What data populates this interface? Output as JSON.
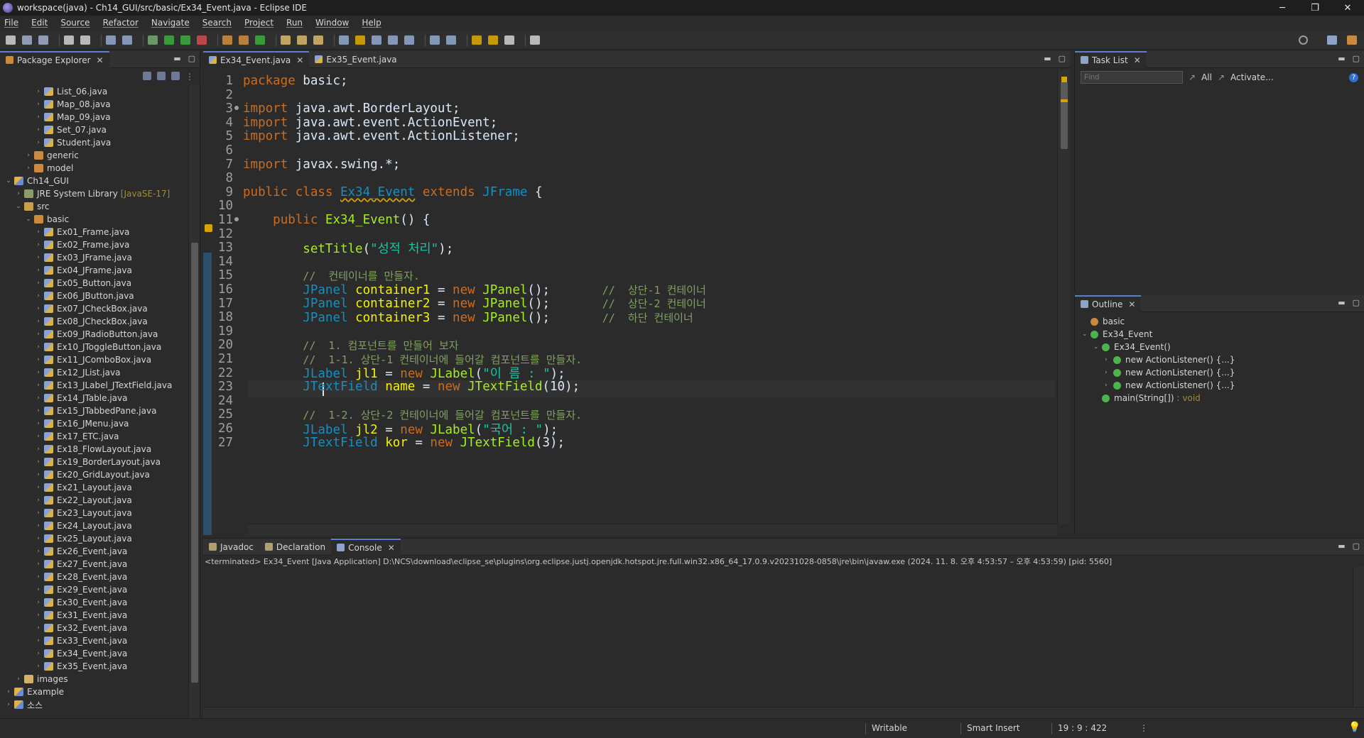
{
  "window": {
    "title": "workspace(java) - Ch14_GUI/src/basic/Ex34_Event.java - Eclipse IDE",
    "minimize": "─",
    "maximize": "❐",
    "close": "✕"
  },
  "menu": [
    "File",
    "Edit",
    "Source",
    "Refactor",
    "Navigate",
    "Search",
    "Project",
    "Run",
    "Window",
    "Help"
  ],
  "package_explorer": {
    "tab": "Package Explorer",
    "rows": [
      {
        "label": "List_06.java",
        "level": 3,
        "icon": "java"
      },
      {
        "label": "Map_08.java",
        "level": 3,
        "icon": "java"
      },
      {
        "label": "Map_09.java",
        "level": 3,
        "icon": "java"
      },
      {
        "label": "Set_07.java",
        "level": 3,
        "icon": "java"
      },
      {
        "label": "Student.java",
        "level": 3,
        "icon": "java"
      },
      {
        "label": "generic",
        "level": 2,
        "icon": "pkg"
      },
      {
        "label": "model",
        "level": 2,
        "icon": "pkg"
      },
      {
        "label": "Ch14_GUI",
        "level": 0,
        "icon": "proj",
        "expanded": true
      },
      {
        "label": "JRE System Library",
        "decor": "[JavaSE-17]",
        "level": 1,
        "icon": "lib"
      },
      {
        "label": "src",
        "level": 1,
        "icon": "src",
        "expanded": true
      },
      {
        "label": "basic",
        "level": 2,
        "icon": "pkg",
        "expanded": true
      },
      {
        "label": "Ex01_Frame.java",
        "level": 3,
        "icon": "java"
      },
      {
        "label": "Ex02_Frame.java",
        "level": 3,
        "icon": "java"
      },
      {
        "label": "Ex03_JFrame.java",
        "level": 3,
        "icon": "java"
      },
      {
        "label": "Ex04_JFrame.java",
        "level": 3,
        "icon": "java"
      },
      {
        "label": "Ex05_Button.java",
        "level": 3,
        "icon": "java"
      },
      {
        "label": "Ex06_JButton.java",
        "level": 3,
        "icon": "java"
      },
      {
        "label": "Ex07_JCheckBox.java",
        "level": 3,
        "icon": "java"
      },
      {
        "label": "Ex08_JCheckBox.java",
        "level": 3,
        "icon": "java"
      },
      {
        "label": "Ex09_JRadioButton.java",
        "level": 3,
        "icon": "java"
      },
      {
        "label": "Ex10_JToggleButton.java",
        "level": 3,
        "icon": "java"
      },
      {
        "label": "Ex11_JComboBox.java",
        "level": 3,
        "icon": "java"
      },
      {
        "label": "Ex12_JList.java",
        "level": 3,
        "icon": "java"
      },
      {
        "label": "Ex13_JLabel_JTextField.java",
        "level": 3,
        "icon": "java"
      },
      {
        "label": "Ex14_JTable.java",
        "level": 3,
        "icon": "java"
      },
      {
        "label": "Ex15_JTabbedPane.java",
        "level": 3,
        "icon": "java"
      },
      {
        "label": "Ex16_JMenu.java",
        "level": 3,
        "icon": "java"
      },
      {
        "label": "Ex17_ETC.java",
        "level": 3,
        "icon": "java"
      },
      {
        "label": "Ex18_FlowLayout.java",
        "level": 3,
        "icon": "java"
      },
      {
        "label": "Ex19_BorderLayout.java",
        "level": 3,
        "icon": "java"
      },
      {
        "label": "Ex20_GridLayout.java",
        "level": 3,
        "icon": "java"
      },
      {
        "label": "Ex21_Layout.java",
        "level": 3,
        "icon": "java"
      },
      {
        "label": "Ex22_Layout.java",
        "level": 3,
        "icon": "java"
      },
      {
        "label": "Ex23_Layout.java",
        "level": 3,
        "icon": "java"
      },
      {
        "label": "Ex24_Layout.java",
        "level": 3,
        "icon": "java"
      },
      {
        "label": "Ex25_Layout.java",
        "level": 3,
        "icon": "java"
      },
      {
        "label": "Ex26_Event.java",
        "level": 3,
        "icon": "java"
      },
      {
        "label": "Ex27_Event.java",
        "level": 3,
        "icon": "java"
      },
      {
        "label": "Ex28_Event.java",
        "level": 3,
        "icon": "java"
      },
      {
        "label": "Ex29_Event.java",
        "level": 3,
        "icon": "java"
      },
      {
        "label": "Ex30_Event.java",
        "level": 3,
        "icon": "java"
      },
      {
        "label": "Ex31_Event.java",
        "level": 3,
        "icon": "java"
      },
      {
        "label": "Ex32_Event.java",
        "level": 3,
        "icon": "java"
      },
      {
        "label": "Ex33_Event.java",
        "level": 3,
        "icon": "java"
      },
      {
        "label": "Ex34_Event.java",
        "level": 3,
        "icon": "java"
      },
      {
        "label": "Ex35_Event.java",
        "level": 3,
        "icon": "java"
      },
      {
        "label": "images",
        "level": 1,
        "icon": "folder"
      },
      {
        "label": "Example",
        "level": 0,
        "icon": "proj"
      },
      {
        "label": "소스",
        "level": 0,
        "icon": "proj"
      }
    ]
  },
  "editor": {
    "tabs": [
      {
        "label": "Ex34_Event.java",
        "active": true
      },
      {
        "label": "Ex35_Event.java",
        "active": false
      }
    ],
    "lines": [
      {
        "n": "1",
        "html": "<span class='kw'>package</span> basic;"
      },
      {
        "n": "2",
        "html": ""
      },
      {
        "n": "3",
        "html": "<span class='kw'>import</span> java.awt.BorderLayout;"
      },
      {
        "n": "4",
        "html": "<span class='kw'>import</span> java.awt.event.ActionEvent;"
      },
      {
        "n": "5",
        "html": "<span class='kw'>import</span> java.awt.event.ActionListener;"
      },
      {
        "n": "6",
        "html": ""
      },
      {
        "n": "7",
        "html": "<span class='kw'>import</span> javax.swing.*;"
      },
      {
        "n": "8",
        "html": ""
      },
      {
        "n": "9",
        "html": "<span class='kw'>public class</span> <span class='cl'>Ex34_Event</span> <span class='kw'>extends</span> <span class='ty'>JFrame</span> {"
      },
      {
        "n": "10",
        "html": ""
      },
      {
        "n": "11",
        "html": "    <span class='kw'>public</span> <span class='fn'>Ex34_Event</span>() {"
      },
      {
        "n": "12",
        "html": ""
      },
      {
        "n": "13",
        "html": "        <span class='fn'>setTitle</span>(<span class='st'>\"성적 처리\"</span>);"
      },
      {
        "n": "14",
        "html": ""
      },
      {
        "n": "15",
        "html": "        <span class='cm'>//  컨테이너를 만들자.</span>"
      },
      {
        "n": "16",
        "html": "        <span class='ty'>JPanel</span> <span class='ident'>container1</span> = <span class='kw'>new</span> <span class='fn'>JPanel</span>();       <span class='cm'>//  상단-1 컨테이너</span>"
      },
      {
        "n": "17",
        "html": "        <span class='ty'>JPanel</span> <span class='ident'>container2</span> = <span class='kw'>new</span> <span class='fn'>JPanel</span>();       <span class='cm'>//  상단-2 컨테이너</span>"
      },
      {
        "n": "18",
        "html": "        <span class='ty'>JPanel</span> <span class='ident'>container3</span> = <span class='kw'>new</span> <span class='fn'>JPanel</span>();       <span class='cm'>//  하단 컨테이너</span>"
      },
      {
        "n": "19",
        "html": "        "
      },
      {
        "n": "20",
        "html": "        <span class='cm'>//  1. 컴포넌트를 만들어 보자</span>"
      },
      {
        "n": "21",
        "html": "        <span class='cm'>//  1-1. 상단-1 컨테이너에 들어갈 컴포넌트를 만들자.</span>"
      },
      {
        "n": "22",
        "html": "        <span class='ty'>JLabel</span> <span class='ident'>jl1</span> = <span class='kw'>new</span> <span class='fn'>JLabel</span>(<span class='st'>\"이 름 : \"</span>);"
      },
      {
        "n": "23",
        "html": "        <span class='ty'>JTextField</span> <span class='ident'>name</span> = <span class='kw'>new</span> <span class='fn'>JTextField</span>(10);"
      },
      {
        "n": "24",
        "html": ""
      },
      {
        "n": "25",
        "html": "        <span class='cm'>//  1-2. 상단-2 컨테이너에 들어갈 컴포넌트를 만들자.</span>"
      },
      {
        "n": "26",
        "html": "        <span class='ty'>JLabel</span> <span class='ident'>jl2</span> = <span class='kw'>new</span> <span class='fn'>JLabel</span>(<span class='st'>\"국어 : \"</span>);"
      },
      {
        "n": "27",
        "html": "        <span class='ty'>JTextField</span> <span class='ident'>kor</span> = <span class='kw'>new</span> <span class='fn'>JTextField</span>(3);"
      }
    ]
  },
  "task_list": {
    "tab": "Task List",
    "find_placeholder": "Find",
    "all": "All",
    "activate": "Activate..."
  },
  "outline": {
    "tab": "Outline",
    "rows": [
      {
        "label": "basic",
        "level": 0,
        "color": "#c98a3e"
      },
      {
        "label": "Ex34_Event",
        "level": 0,
        "color": "#4db34d",
        "expanded": true
      },
      {
        "label": "Ex34_Event()",
        "level": 1,
        "color": "#4db34d",
        "expanded": true
      },
      {
        "label": "new ActionListener() {...}",
        "level": 2,
        "color": "#4db34d"
      },
      {
        "label": "new ActionListener() {...}",
        "level": 2,
        "color": "#4db34d"
      },
      {
        "label": "new ActionListener() {...}",
        "level": 2,
        "color": "#4db34d"
      },
      {
        "label": "main(String[])",
        "ret": ": void",
        "level": 1,
        "color": "#4db34d"
      }
    ]
  },
  "bottom_panel": {
    "tabs": [
      {
        "label": "Javadoc",
        "active": false
      },
      {
        "label": "Declaration",
        "active": false
      },
      {
        "label": "Console",
        "active": true
      }
    ],
    "console_meta": "<terminated> Ex34_Event [Java Application] D:\\NCS\\download\\eclipse_se\\plugins\\org.eclipse.justj.openjdk.hotspot.jre.full.win32.x86_64_17.0.9.v20231028-0858\\jre\\bin\\javaw.exe  (2024. 11. 8. 오후 4:53:57 – 오후 4:53:59) [pid: 5560]"
  },
  "status": {
    "writable": "Writable",
    "insert_mode": "Smart Insert",
    "position": "19 : 9 : 422"
  }
}
